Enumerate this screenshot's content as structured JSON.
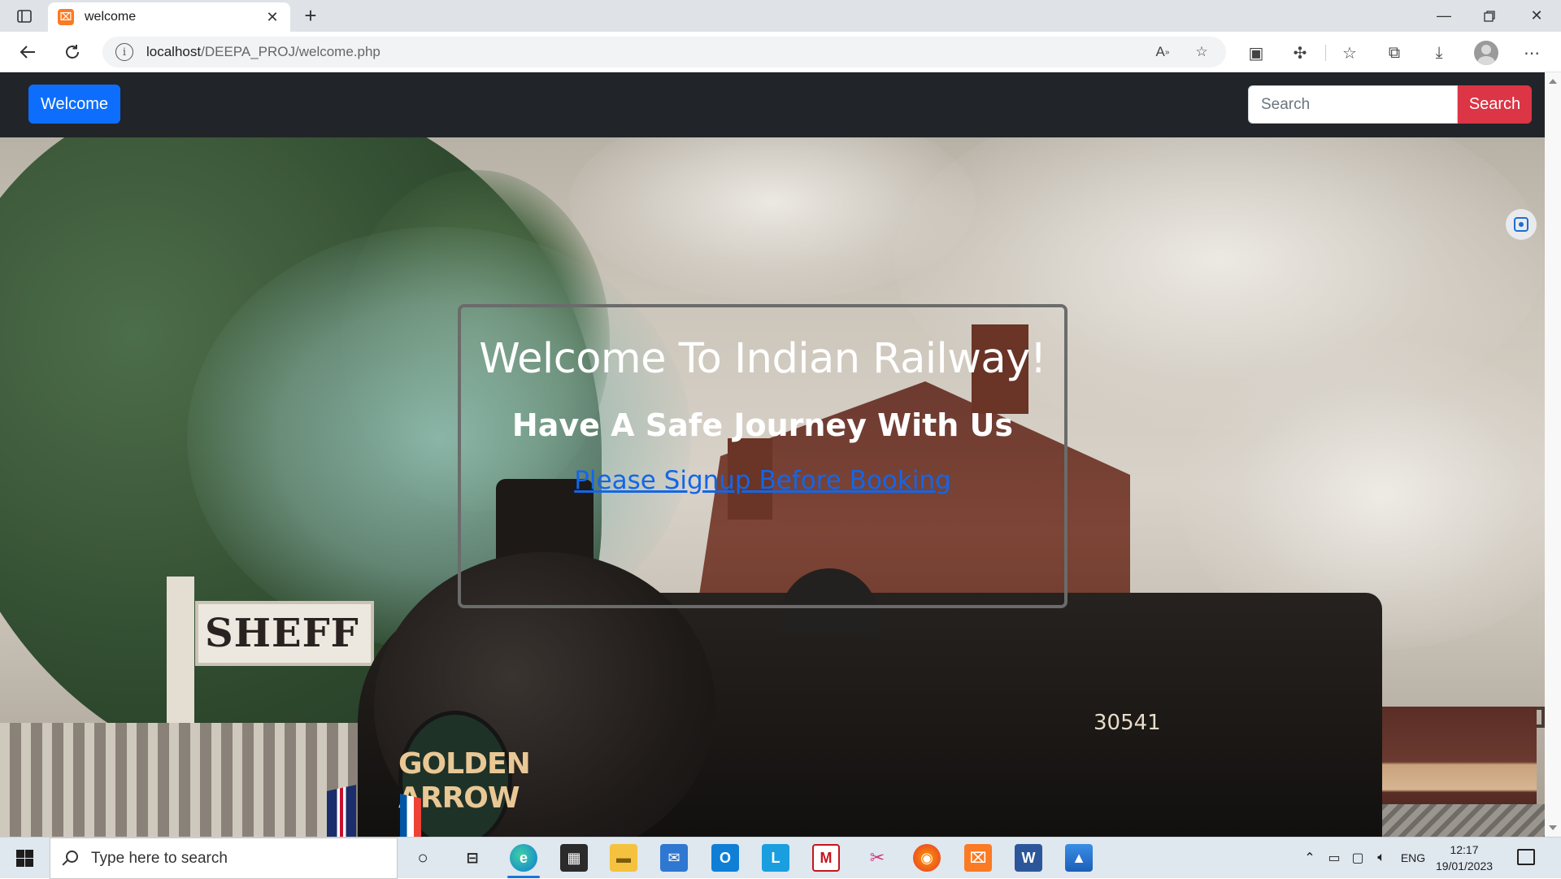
{
  "browser": {
    "tab_title": "welcome",
    "url_host": "localhost",
    "url_path": "/DEEPA_PROJ/welcome.php"
  },
  "site": {
    "brand_label": "Welcome",
    "search_placeholder": "Search",
    "search_button": "Search"
  },
  "hero": {
    "title": "Welcome To Indian Railway!",
    "subtitle": "Have A Safe Journey With Us",
    "signup_link": "Please Signup Before Booking",
    "engine_disc_line1": "GOLDEN",
    "engine_disc_line2": "ARROW",
    "station_sign": "SHEFF",
    "engine_number": "30541"
  },
  "taskbar": {
    "search_placeholder": "Type here to search",
    "language": "ENG",
    "time": "12:17",
    "date": "19/01/2023"
  },
  "colors": {
    "brand_button": "#0d6efd",
    "search_button": "#dc3545",
    "navbar": "#212529",
    "link": "#1366e8"
  }
}
